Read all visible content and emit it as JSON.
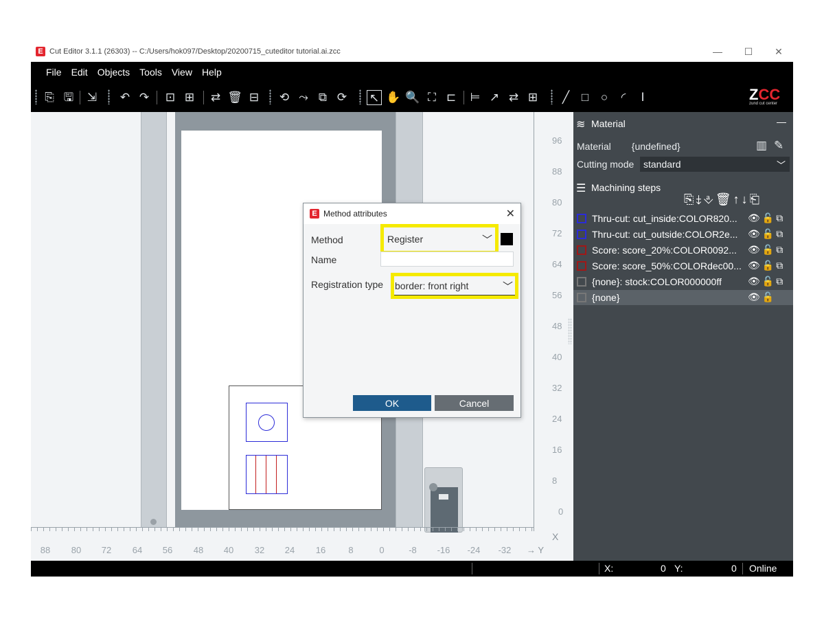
{
  "window": {
    "title": "Cut Editor 3.1.1 (26303)  --  C:/Users/hok097/Desktop/20200715_cuteditor tutorial.ai.zcc",
    "logo_letter": "E",
    "minimize": "—",
    "maximize": "☐",
    "close": "✕"
  },
  "menu": [
    "File",
    "Edit",
    "Objects",
    "Tools",
    "View",
    "Help"
  ],
  "toolbar": {
    "logo_text": "ZCC",
    "logo_sub": "zund cut center"
  },
  "ruler": {
    "vertical": [
      "96",
      "88",
      "80",
      "72",
      "64",
      "56",
      "48",
      "40",
      "32",
      "24",
      "16",
      "8",
      "0"
    ],
    "horizontal": [
      "88",
      "80",
      "72",
      "64",
      "56",
      "48",
      "40",
      "32",
      "24",
      "16",
      "8",
      "0",
      "-8",
      "-16",
      "-24",
      "-32"
    ],
    "x_axis": "X",
    "y_axis": "→ Y"
  },
  "panel": {
    "material_header": "Material",
    "collapse": "—",
    "material_label": "Material",
    "material_value": "{undefined}",
    "cutting_mode_label": "Cutting mode",
    "cutting_mode_value": "standard",
    "machining_header": "Machining steps",
    "steps": [
      {
        "label": "Thru-cut: cut_inside:COLOR820...",
        "color": "#2b2bd8"
      },
      {
        "label": "Thru-cut: cut_outside:COLOR2e...",
        "color": "#2b2bd8"
      },
      {
        "label": "Score: score_20%:COLOR0092...",
        "color": "#a01818"
      },
      {
        "label": "Score: score_50%:COLORdec00...",
        "color": "#a01818"
      },
      {
        "label": "{none}: stock:COLOR000000ff",
        "color": "#777777"
      },
      {
        "label": "{none}",
        "color": "#777777"
      }
    ]
  },
  "status": {
    "x_label": "X:",
    "x_value": "0",
    "y_label": "Y:",
    "y_value": "0",
    "state": "Online"
  },
  "dialog": {
    "title": "Method attributes",
    "close": "✕",
    "method_label": "Method",
    "method_value": "Register",
    "name_label": "Name",
    "name_value": "",
    "registration_label": "Registration type",
    "registration_value": "border: front right",
    "ok": "OK",
    "cancel": "Cancel",
    "highlight_color": "#f5ea00"
  }
}
